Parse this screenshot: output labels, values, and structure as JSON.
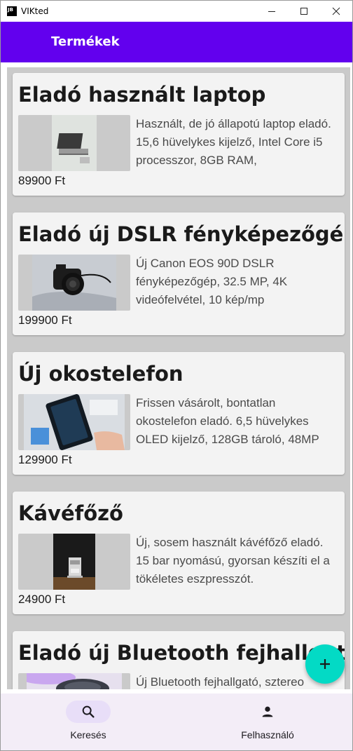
{
  "window": {
    "title": "VIKted",
    "app_icon_text": "JB",
    "minimize_glyph": "—",
    "maximize_glyph": "☐",
    "close_glyph": "✕"
  },
  "appbar": {
    "title": "Termékek",
    "color": "#6200ee"
  },
  "products": [
    {
      "title": "Eladó használt laptop",
      "description": "Használt, de jó állapotú laptop eladó. 15,6 hüvelykes kijelző, Intel Core i5 processzor, 8GB RAM,",
      "price": "89900 Ft"
    },
    {
      "title": "Eladó új DSLR fényképezőgép",
      "description": "Új Canon EOS 90D DSLR fényképezőgép, 32.5 MP, 4K videófelvétel, 10 kép/mp",
      "price": "199900 Ft"
    },
    {
      "title": "Új okostelefon",
      "description": "Frissen vásárolt, bontatlan okostelefon eladó. 6,5 hüvelykes OLED kijelző, 128GB tároló, 48MP",
      "price": "129900 Ft"
    },
    {
      "title": "Kávéfőző",
      "description": "Új, sosem használt kávéfőző eladó. 15 bar nyomású, gyorsan készíti el a tökéletes eszpresszót.",
      "price": "24900 Ft"
    },
    {
      "title": "Eladó új Bluetooth fejhallgató",
      "description": "Új Bluetooth fejhallgató, sztereo",
      "price": ""
    }
  ],
  "fab": {
    "icon": "plus-icon",
    "color": "#03dac5"
  },
  "bottom_nav": {
    "items": [
      {
        "label": "Keresés",
        "icon": "search-icon",
        "active": true
      },
      {
        "label": "Felhasználó",
        "icon": "person-icon",
        "active": false
      }
    ],
    "indicator_color": "#e8def8"
  }
}
